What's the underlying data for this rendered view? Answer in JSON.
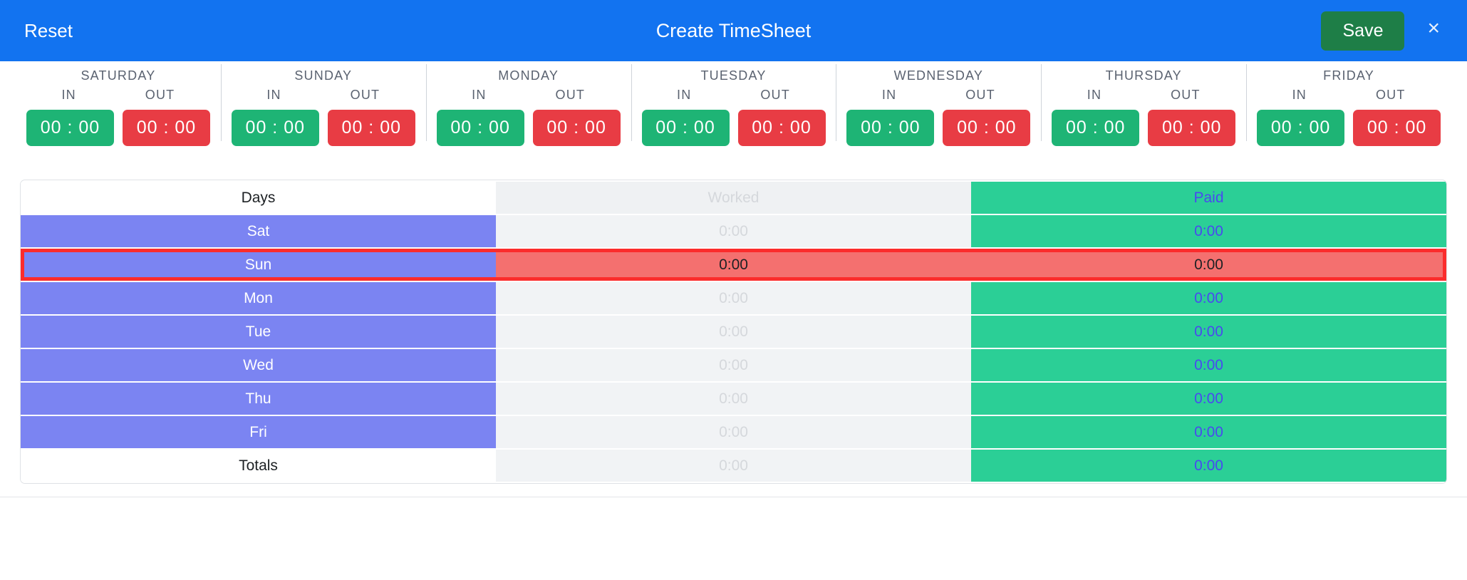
{
  "header": {
    "reset_label": "Reset",
    "title": "Create TimeSheet",
    "save_label": "Save",
    "close_label": "×",
    "bar_color": "#1273f0",
    "save_color": "#1e7e47"
  },
  "daystrip": {
    "in_label": "IN",
    "out_label": "OUT",
    "in_color": "#1eb475",
    "out_color": "#e83c44",
    "columns": [
      {
        "name": "SATURDAY",
        "in_value": "00 : 00",
        "out_value": "00 : 00"
      },
      {
        "name": "SUNDAY",
        "in_value": "00 : 00",
        "out_value": "00 : 00"
      },
      {
        "name": "MONDAY",
        "in_value": "00 : 00",
        "out_value": "00 : 00"
      },
      {
        "name": "TUESDAY",
        "in_value": "00 : 00",
        "out_value": "00 : 00"
      },
      {
        "name": "WEDNESDAY",
        "in_value": "00 : 00",
        "out_value": "00 : 00"
      },
      {
        "name": "THURSDAY",
        "in_value": "00 : 00",
        "out_value": "00 : 00"
      },
      {
        "name": "FRIDAY",
        "in_value": "00 : 00",
        "out_value": "00 : 00"
      }
    ]
  },
  "table": {
    "columns": [
      "Days",
      "Worked",
      "Paid"
    ],
    "day_color": "#7b84f2",
    "paid_color": "#2bcf96",
    "worked_color": "#f1f3f5",
    "highlight_color": "#fb2c2c",
    "highlight_fill": "#f4706f",
    "rows": [
      {
        "day": "Sat",
        "worked": "0:00",
        "paid": "0:00",
        "highlighted": false
      },
      {
        "day": "Sun",
        "worked": "0:00",
        "paid": "0:00",
        "highlighted": true
      },
      {
        "day": "Mon",
        "worked": "0:00",
        "paid": "0:00",
        "highlighted": false
      },
      {
        "day": "Tue",
        "worked": "0:00",
        "paid": "0:00",
        "highlighted": false
      },
      {
        "day": "Wed",
        "worked": "0:00",
        "paid": "0:00",
        "highlighted": false
      },
      {
        "day": "Thu",
        "worked": "0:00",
        "paid": "0:00",
        "highlighted": false
      },
      {
        "day": "Fri",
        "worked": "0:00",
        "paid": "0:00",
        "highlighted": false
      }
    ],
    "totals": {
      "label": "Totals",
      "worked": "0:00",
      "paid": "0:00"
    }
  }
}
